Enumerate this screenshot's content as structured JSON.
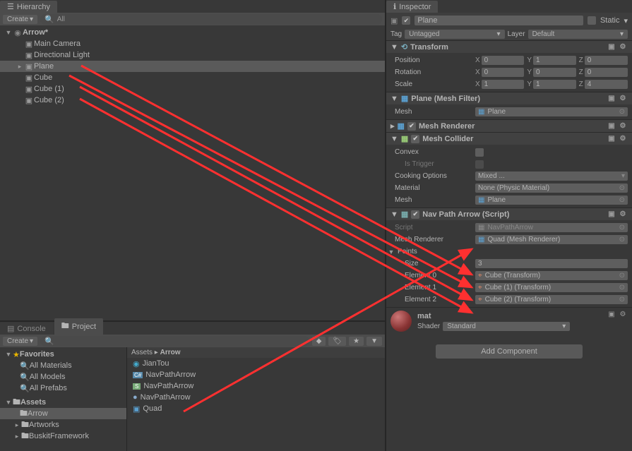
{
  "hierarchy": {
    "tab": "Hierarchy",
    "create": "Create",
    "search_prefix": "All",
    "scene": "Arrow*",
    "rows": [
      "Main Camera",
      "Directional Light",
      "Plane",
      "Cube",
      "Cube (1)",
      "Cube (2)"
    ],
    "selected": "Plane"
  },
  "projectTabs": {
    "console": "Console",
    "project": "Project"
  },
  "project": {
    "create": "Create",
    "favorites": "Favorites",
    "fav_items": [
      "All Materials",
      "All Models",
      "All Prefabs"
    ],
    "assets": "Assets",
    "folders": [
      "Arrow",
      "Artworks",
      "BuskitFramework"
    ],
    "selected_folder": "Arrow",
    "breadcrumb": [
      "Assets",
      "Arrow"
    ],
    "items": [
      {
        "name": "JianTou",
        "icon": "material"
      },
      {
        "name": "NavPathArrow",
        "icon": "cs"
      },
      {
        "name": "NavPathArrow",
        "icon": "cs-mono"
      },
      {
        "name": "NavPathArrow",
        "icon": "material"
      },
      {
        "name": "Quad",
        "icon": "prefab"
      }
    ]
  },
  "inspector": {
    "tab": "Inspector",
    "name": "Plane",
    "enabled": true,
    "static_label": "Static",
    "tag_label": "Tag",
    "tag_value": "Untagged",
    "layer_label": "Layer",
    "layer_value": "Default",
    "transform": {
      "title": "Transform",
      "position_label": "Position",
      "pos": {
        "x": "0",
        "y": "1",
        "z": "0"
      },
      "rotation_label": "Rotation",
      "rot": {
        "x": "0",
        "y": "0",
        "z": "0"
      },
      "scale_label": "Scale",
      "scl": {
        "x": "1",
        "y": "1",
        "z": "4"
      }
    },
    "mesh_filter": {
      "title": "Plane (Mesh Filter)",
      "mesh_label": "Mesh",
      "mesh_value": "Plane"
    },
    "mesh_renderer": {
      "title": "Mesh Renderer"
    },
    "mesh_collider": {
      "title": "Mesh Collider",
      "convex_label": "Convex",
      "trigger_label": "Is Trigger",
      "cooking_label": "Cooking Options",
      "cooking_value": "Mixed ...",
      "material_label": "Material",
      "material_value": "None (Physic Material)",
      "mesh_label": "Mesh",
      "mesh_value": "Plane"
    },
    "nav_path": {
      "title": "Nav Path Arrow (Script)",
      "script_label": "Script",
      "script_value": "NavPathArrow",
      "mr_label": "Mesh Renderer",
      "mr_value": "Quad (Mesh Renderer)",
      "points_label": "Points",
      "size_label": "Size",
      "size_value": "3",
      "e0": "Element 0",
      "e0v": "Cube (Transform)",
      "e1": "Element 1",
      "e1v": "Cube (1) (Transform)",
      "e2": "Element 2",
      "e2v": "Cube (2) (Transform)"
    },
    "material": {
      "name": "mat",
      "shader_label": "Shader",
      "shader_value": "Standard"
    },
    "add_component": "Add Component"
  }
}
